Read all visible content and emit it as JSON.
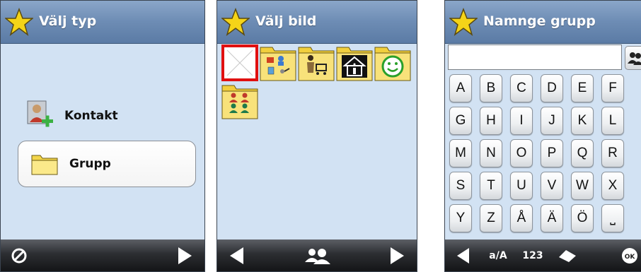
{
  "screens": {
    "type_select": {
      "title": "Välj typ",
      "options": [
        {
          "label": "Kontakt",
          "icon": "add-contact-icon"
        },
        {
          "label": "Grupp",
          "icon": "folder-icon",
          "selected": true
        }
      ],
      "bottom_bar": {
        "left_icon": "cancel-icon",
        "right_icon": "forward-arrow-icon"
      }
    },
    "image_select": {
      "title": "Välj bild",
      "thumbnails": [
        {
          "icon": "no-image-icon",
          "selected": true,
          "selection_color": "#e01010"
        },
        {
          "icon": "folder-people-devices-icon"
        },
        {
          "icon": "folder-person-cart-icon"
        },
        {
          "icon": "folder-house-info-icon"
        },
        {
          "icon": "folder-smiley-icon"
        },
        {
          "icon": "folder-group-icon"
        }
      ],
      "bottom_bar": {
        "left_icon": "back-arrow-icon",
        "center_icon": "contacts-icon",
        "right_icon": "forward-arrow-icon"
      }
    },
    "name_group": {
      "title": "Namnge grupp",
      "input": {
        "value": "",
        "placeholder": ""
      },
      "keyboard_rows": [
        [
          "A",
          "B",
          "C",
          "D",
          "E",
          "F"
        ],
        [
          "G",
          "H",
          "I",
          "J",
          "K",
          "L"
        ],
        [
          "M",
          "N",
          "O",
          "P",
          "Q",
          "R"
        ],
        [
          "S",
          "T",
          "U",
          "V",
          "W",
          "X"
        ],
        [
          "Y",
          "Z",
          "Å",
          "Ä",
          "Ö",
          "⎵"
        ]
      ],
      "bottom_bar": {
        "left_icon": "back-arrow-icon",
        "case_toggle_label": "a/A",
        "numbers_label": "123",
        "eraser_icon": "eraser-icon",
        "ok_label": "OK"
      }
    }
  },
  "colors": {
    "title_bar": "#6d8cb4",
    "content_bg": "#d2e2f3",
    "bottom_bar": "#2c2e32",
    "star": "#f5d418"
  }
}
